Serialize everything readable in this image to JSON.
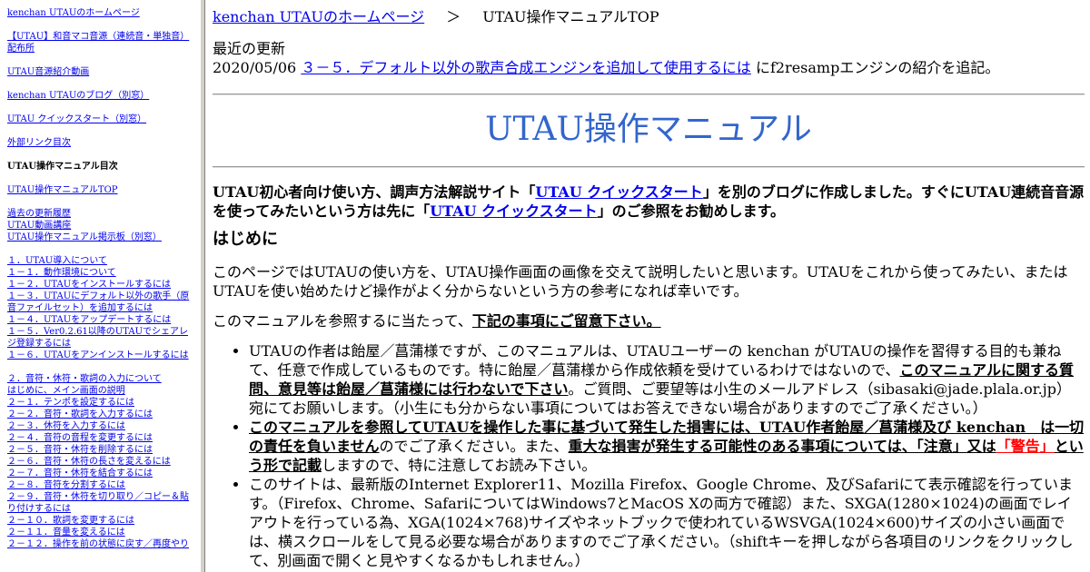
{
  "sidebar": {
    "groups": [
      [
        {
          "text": "kenchan UTAUのホームページ",
          "link": true
        }
      ],
      [
        {
          "text": "【UTAU】和音マコ音源（連続音・単独音）配布所",
          "link": true
        }
      ],
      [
        {
          "text": "UTAU音源紹介動画",
          "link": true
        }
      ],
      [
        {
          "text": "kenchan UTAUのブログ（別窓）",
          "link": true
        }
      ],
      [
        {
          "text": "UTAU クイックスタート（別窓）",
          "link": true
        }
      ],
      [
        {
          "text": "外部リンク目次",
          "link": true
        }
      ],
      [
        {
          "text": "UTAU操作マニュアル目次",
          "link": false
        }
      ],
      [
        {
          "text": "UTAU操作マニュアルTOP",
          "link": true
        }
      ],
      [
        {
          "text": "過去の更新履歴",
          "link": true
        },
        {
          "text": "UTAU動画講座",
          "link": true
        },
        {
          "text": "UTAU操作マニュアル掲示板（別窓）",
          "link": true
        }
      ],
      [
        {
          "text": "１．UTAU導入について",
          "link": true
        },
        {
          "text": "１－１．動作環境について",
          "link": true
        },
        {
          "text": "１－２．UTAUをインストールするには",
          "link": true
        },
        {
          "text": "１－３．UTAUにデフォルト以外の歌手（原音ファイルセット）を追加するには",
          "link": true
        },
        {
          "text": "１－４．UTAUをアップデートするには",
          "link": true
        },
        {
          "text": "１－５．Ver0.2.61以降のUTAUでシェアレジ登録するには",
          "link": true
        },
        {
          "text": "１－６．UTAUをアンインストールするには",
          "link": true
        }
      ],
      [
        {
          "text": "２．音符・休符・歌詞の入力について",
          "link": true
        },
        {
          "text": "はじめに、メイン画面の説明",
          "link": true
        },
        {
          "text": "２－１．テンポを設定するには",
          "link": true
        },
        {
          "text": "２－２．音符・歌詞を入力するには",
          "link": true
        },
        {
          "text": "２－３．休符を入力するには",
          "link": true
        },
        {
          "text": "２－４．音符の音程を変更するには",
          "link": true
        },
        {
          "text": "２－５．音符・休符を削除するには",
          "link": true
        },
        {
          "text": "２－６．音符・休符の長さを変えるには",
          "link": true
        },
        {
          "text": "２－７．音符・休符を結合するには",
          "link": true
        },
        {
          "text": "２－８．音符を分割するには",
          "link": true
        },
        {
          "text": "２－９．音符・休符を切り取り／コピー＆貼り付けするには",
          "link": true
        },
        {
          "text": "２－１０．歌詞を変更するには",
          "link": true
        },
        {
          "text": "２－１１．音量を変えるには",
          "link": true
        },
        {
          "text": "２－１２．操作を前の状態に戻す／再度やり",
          "link": true
        }
      ]
    ]
  },
  "breadcrumb": {
    "home": "kenchan UTAUのホームページ",
    "sep": "＞",
    "current": "UTAU操作マニュアルTOP"
  },
  "recent": {
    "heading": "最近の更新",
    "date": "2020/05/06",
    "link": "３－５．デフォルト以外の歌声合成エンジンを追加して使用するには",
    "tail": "にf2resampエンジンの紹介を追記。"
  },
  "title": "UTAU操作マニュアル",
  "intro": {
    "p1": "UTAU初心者向け使い方、調声方法解説サイト「",
    "link1": "UTAU クイックスタート",
    "p2": "」を別のブログに作成しました。すぐにUTAU連続音音源を使ってみたいという方は先に「",
    "link2": "UTAU クイックスタート",
    "p3": "」のご参照をお勧めします。"
  },
  "section": {
    "heading": "はじめに",
    "para1": "このページではUTAUの使い方を、UTAU操作画面の画像を交えて説明したいと思います。UTAUをこれから使ってみたい、またはUTAUを使い始めたけど操作がよく分からないという方の参考になれば幸いです。",
    "para2a": "このマニュアルを参照するに当たって、",
    "para2b": "下記の事項にご留意下さい。"
  },
  "bullets": {
    "b1a": "UTAUの作者は飴屋／菖蒲様ですが、このマニュアルは、UTAUユーザーの kenchan がUTAUの操作を習得する目的も兼ねて、任意で作成しているものです。特に飴屋／菖蒲様から作成依頼を受けているわけではないので、",
    "b1b": "このマニュアルに関する質問、意見等は飴屋／菖蒲様には行わないで下さい",
    "b1c": "。ご質問、ご要望等は小生のメールアドレス（sibasaki@jade.plala.or.jp）宛にてお願いします。（小生にも分からない事項についてはお答えできない場合がありますのでご了承ください。）",
    "b2a": "このマニュアルを参照してUTAUを操作した事に基づいて発生した損害には、UTAU作者飴屋／菖蒲様及び kenchan　は一切の責任を負いません",
    "b2b": "のでご了承ください。また、",
    "b2c": "重大な損害が発生する可能性のある事項については、「注意」又は",
    "b2d": "「警告」",
    "b2e": "という形で記載",
    "b2f": "しますので、特に注意してお読み下さい。",
    "b3": "このサイトは、最新版のInternet Explorer11、Mozilla Firefox、Google Chrome、及びSafariにて表示確認を行っています。（Firefox、Chrome、SafariについてはWindows7とMacOS Xの両方で確認）また、SXGA(1280×1024)の画面でレイアウトを行っている為、XGA(1024×768)サイズやネットブックで使われているWSVGA(1024×600)サイズの小さい画面では、横スクロールをして見る必要な場合がありますのでご了承ください。（shiftキーを押しながら各項目のリンクをクリックして、別画面で開くと見やすくなるかもしれません。）"
  }
}
